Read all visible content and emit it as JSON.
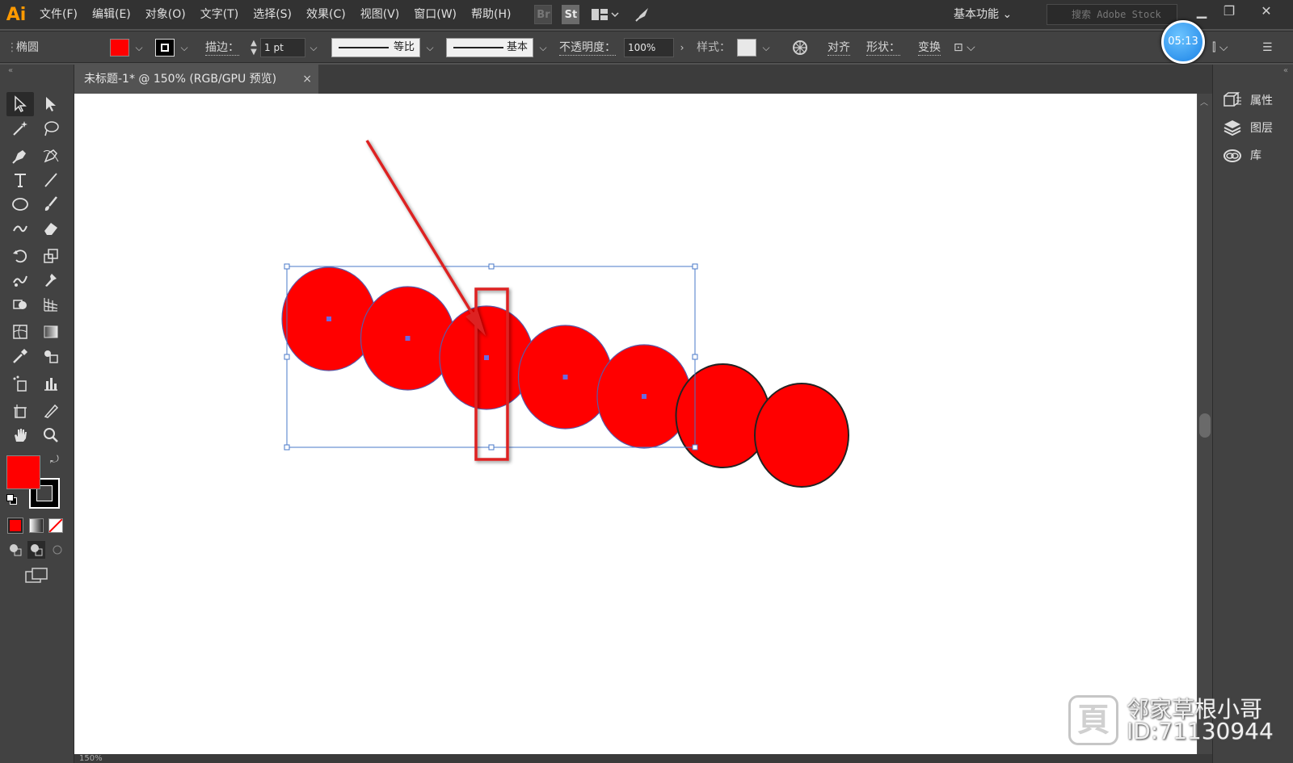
{
  "app": {
    "logo": "Ai"
  },
  "menu": [
    "文件(F)",
    "编辑(E)",
    "对象(O)",
    "文字(T)",
    "选择(S)",
    "效果(C)",
    "视图(V)",
    "窗口(W)",
    "帮助(H)"
  ],
  "menubar_icons": {
    "bridge": "Br",
    "stock": "St"
  },
  "workspace": {
    "label": "基本功能"
  },
  "search": {
    "placeholder": "搜索 Adobe Stock"
  },
  "control_bar": {
    "object_type": "椭圆",
    "fill_color": "#ff0000",
    "stroke_label": "描边：",
    "stroke_weight": "1 pt",
    "profile_label": "等比",
    "brush_label": "基本",
    "opacity_label": "不透明度：",
    "opacity_value": "100%",
    "style_label": "样式：",
    "align_label": "对齐",
    "shape_label": "形状：",
    "transform_label": "变换"
  },
  "timer": "05:13",
  "document_tab": {
    "title": "未标题-1* @ 150% (RGB/GPU 预览)",
    "close": "×"
  },
  "right_panel": [
    {
      "label": "属性",
      "icon": "properties-icon"
    },
    {
      "label": "图层",
      "icon": "layers-icon"
    },
    {
      "label": "库",
      "icon": "libraries-icon"
    }
  ],
  "tools": {
    "fill_color": "#ff0000",
    "stroke_color": "#000000"
  },
  "watermark": {
    "name": "邻家草根小哥",
    "id": "ID:71130944"
  },
  "artwork": {
    "circle_count": 7,
    "circle_fill": "#ff0000",
    "annotation_color": "#dd2222"
  },
  "status": {
    "zoom": "150%"
  }
}
